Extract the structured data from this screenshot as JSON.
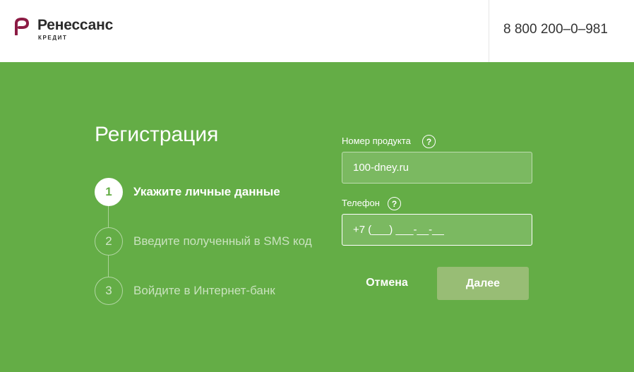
{
  "header": {
    "logo_name": "Ренессанс",
    "logo_sub": "КРЕДИТ",
    "phone": "8 800 200–0–981",
    "brand_color": "#8c1b44"
  },
  "registration": {
    "title": "Регистрация",
    "steps": [
      {
        "number": "1",
        "label": "Укажите личные данные",
        "active": true
      },
      {
        "number": "2",
        "label": "Введите полученный в SMS код",
        "active": false
      },
      {
        "number": "3",
        "label": "Войдите в Интернет-банк",
        "active": false
      }
    ]
  },
  "form": {
    "product": {
      "label": "Номер продукта",
      "help": "?",
      "value": "100-dney.ru"
    },
    "phone": {
      "label": "Телефон",
      "help": "?",
      "value": "+7 (___) ___-__-__"
    },
    "cancel_label": "Отмена",
    "next_label": "Далее"
  },
  "colors": {
    "background": "#64ad46",
    "button_disabled": "#98bd75"
  },
  "icons": {
    "logo": "renaissance-logo-icon",
    "help": "question-circle-icon"
  }
}
